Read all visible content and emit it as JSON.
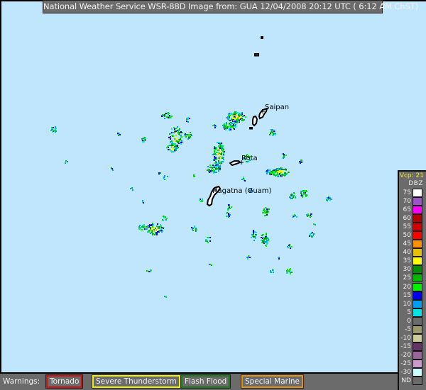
{
  "header": {
    "title": "National Weather Service WSR-88D Image from:  GUA 12/04/2008  20:12 UTC  ( 6:12  AM ChST)"
  },
  "map": {
    "background_color": "#bfe6fd",
    "places": [
      {
        "name": "Saipan",
        "icon": "crosshair-icon"
      },
      {
        "name": "Rota",
        "icon": "crosshair-icon"
      },
      {
        "name": "Hagatna (Guam)",
        "icon": "crosshair-icon"
      }
    ]
  },
  "legend": {
    "vcp_label": "Vcp: 21",
    "unit_label": "DBZ",
    "scale": [
      {
        "label": "75",
        "color": "#ffffff"
      },
      {
        "label": "70",
        "color": "#9955c9"
      },
      {
        "label": "65",
        "color": "#ff00ff"
      },
      {
        "label": "60",
        "color": "#b50000"
      },
      {
        "label": "55",
        "color": "#d40000"
      },
      {
        "label": "50",
        "color": "#ff0000"
      },
      {
        "label": "45",
        "color": "#ff9000"
      },
      {
        "label": "40",
        "color": "#e8c000"
      },
      {
        "label": "35",
        "color": "#ffff00"
      },
      {
        "label": "30",
        "color": "#008c00"
      },
      {
        "label": "25",
        "color": "#00b800"
      },
      {
        "label": "20",
        "color": "#00f000"
      },
      {
        "label": "15",
        "color": "#0000f0"
      },
      {
        "label": "10",
        "color": "#009ef5"
      },
      {
        "label": "5",
        "color": "#00e4e4"
      },
      {
        "label": "0",
        "color": "#6b6b6b"
      },
      {
        "label": "-5",
        "color": "#9a9a6b"
      },
      {
        "label": "-10",
        "color": "#cdcd9c"
      },
      {
        "label": "-15",
        "color": "#663366"
      },
      {
        "label": "-20",
        "color": "#99669a"
      },
      {
        "label": "-25",
        "color": "#cd9acd"
      },
      {
        "label": "-30",
        "color": "#ccffff"
      },
      {
        "label": "ND",
        "color": "#6b6b6b"
      }
    ]
  },
  "warnings": {
    "label": "Warnings:",
    "items": [
      {
        "label": "Tornado",
        "color": "#d01010"
      },
      {
        "label": "Severe Thunderstorm",
        "color": "#f0f000"
      },
      {
        "label": "Flash Flood",
        "color": "#1a7a1a"
      },
      {
        "label": "Special Marine",
        "color": "#e8900a"
      }
    ]
  }
}
